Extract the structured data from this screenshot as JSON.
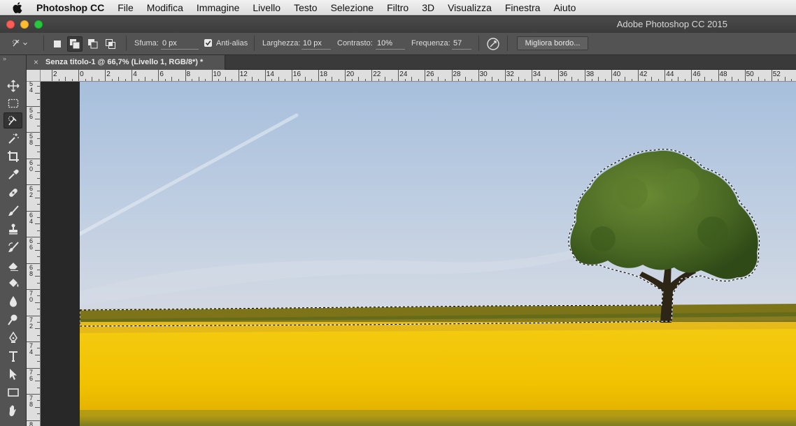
{
  "menubar": {
    "app_name": "Photoshop CC",
    "items": [
      "File",
      "Modifica",
      "Immagine",
      "Livello",
      "Testo",
      "Selezione",
      "Filtro",
      "3D",
      "Visualizza",
      "Finestra",
      "Aiuto"
    ]
  },
  "window": {
    "title": "Adobe Photoshop CC 2015"
  },
  "options_bar": {
    "tool_icon": "quick-selection-icon",
    "selection_modes": [
      "new-selection-icon",
      "add-to-selection-icon",
      "subtract-from-selection-icon",
      "intersect-selection-icon"
    ],
    "active_mode_index": 1,
    "feather": {
      "label": "Sfuma:",
      "value": "0 px"
    },
    "anti_alias": {
      "label": "Anti-alias",
      "checked": true
    },
    "width": {
      "label": "Larghezza:",
      "value": "10 px"
    },
    "contrast": {
      "label": "Contrasto:",
      "value": "10%"
    },
    "frequency": {
      "label": "Frequenza:",
      "value": "57"
    },
    "pen_pressure_icon": "stylus-pressure-icon",
    "refine_edge_label": "Migliora bordo..."
  },
  "document_tab": {
    "close_glyph": "×",
    "title": "Senza titolo-1 @ 66,7% (Livello 1, RGB/8*) *"
  },
  "rulers": {
    "horizontal": [
      "2",
      "0",
      "2",
      "4",
      "6",
      "8",
      "10",
      "12",
      "14",
      "16",
      "18",
      "20",
      "22",
      "24",
      "26",
      "28",
      "30",
      "32",
      "34",
      "36",
      "38",
      "40",
      "42",
      "44",
      "46",
      "48",
      "50",
      "52"
    ],
    "vertical": [
      "54",
      "56",
      "58",
      "60",
      "62",
      "64",
      "66",
      "68",
      "70",
      "72",
      "74",
      "76",
      "78",
      "80"
    ]
  },
  "tools": [
    "move-tool-icon",
    "marquee-tool-icon",
    "quick-selection-tool-icon",
    "magic-wand-icon",
    "crop-tool-icon",
    "eyedropper-icon",
    "healing-brush-icon",
    "brush-tool-icon",
    "clone-stamp-icon",
    "history-brush-icon",
    "eraser-icon",
    "paint-bucket-icon",
    "blur-tool-icon",
    "dodge-tool-icon",
    "pen-tool-icon",
    "type-tool-icon",
    "path-selection-icon",
    "rectangle-tool-icon",
    "hand-tool-icon"
  ],
  "active_tool_index": 2,
  "colors": {
    "sky": "#bccbe0",
    "rapeseed": "#f2c400",
    "tree_foliage": "#4b6a24",
    "ui_panel": "#535353"
  }
}
